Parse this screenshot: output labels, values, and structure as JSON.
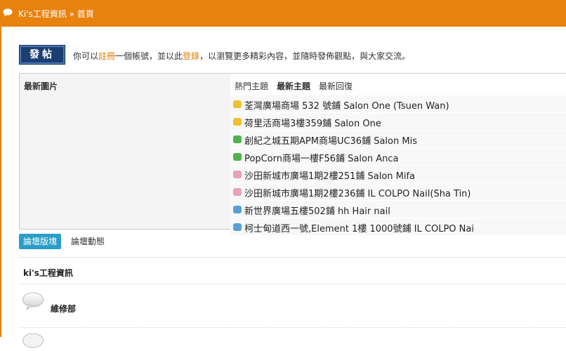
{
  "header": {
    "site_name": "Ki's工程資訊",
    "separator": "»",
    "current": "首頁"
  },
  "post_button": {
    "label": "發帖"
  },
  "welcome": {
    "prefix": "你可以",
    "register": "註冊",
    "middle": "一個帳號，並以此",
    "login": "登錄",
    "suffix": "，以瀏覽更多精彩內容，並隨時發佈觀點，與大家交流。"
  },
  "latest_images": {
    "title": "最新圖片"
  },
  "thread_tabs": [
    "熱門主題",
    "最新主題",
    "最新回復"
  ],
  "thread_tabs_active": 1,
  "threads": [
    {
      "title": "荃灣廣場商場 532 號鋪 Salon One (Tsuen Wan)",
      "icon": "yellow-speech-icon",
      "color": "#f0c030"
    },
    {
      "title": "荷里活商場3樓359鋪 Salon One",
      "icon": "yellow-speech-icon",
      "color": "#f0c030"
    },
    {
      "title": "創紀之城五期APM商場UC36鋪 Salon Mis",
      "icon": "green-speech-icon",
      "color": "#4fb34a"
    },
    {
      "title": "PopCorn商場一樓F56鋪 Salon Anca",
      "icon": "green-speech-icon",
      "color": "#4fb34a"
    },
    {
      "title": "沙田新城市廣場1期2樓251鋪 Salon Mifa",
      "icon": "pink-speech-icon",
      "color": "#e8a0bc"
    },
    {
      "title": "沙田新城市廣場1期2樓236鋪 IL COLPO Nail(Sha Tin)",
      "icon": "pink-speech-icon",
      "color": "#e8a0bc"
    },
    {
      "title": "新世界廣場五樓502鋪 hh Hair nail",
      "icon": "blue-speech-icon",
      "color": "#5aa0d8"
    },
    {
      "title": "柯士甸道西一號,Element 1樓 1000號鋪 IL COLPO Nai",
      "icon": "blue-speech-icon",
      "color": "#5aa0d8"
    }
  ],
  "forum_tabs": [
    "論壇版塊",
    "論壇動態"
  ],
  "category": {
    "title": "ki's工程資訊"
  },
  "forums": [
    {
      "name": "維修部"
    }
  ],
  "colors": {
    "accent": "#e8820f",
    "tab_active": "#2a9ec9",
    "link": "#e07c00"
  }
}
